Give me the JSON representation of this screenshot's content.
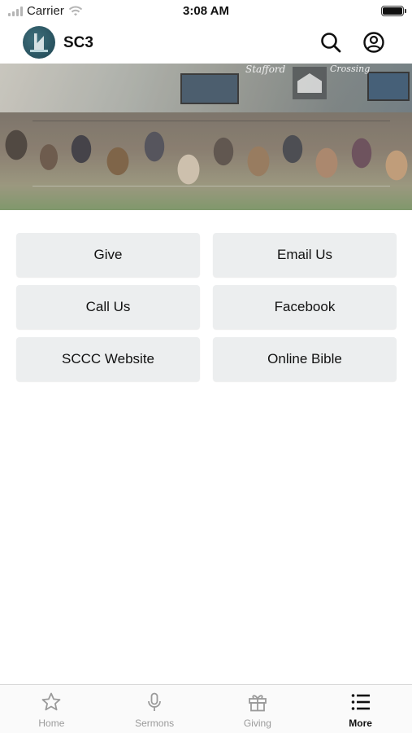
{
  "status_bar": {
    "carrier": "Carrier",
    "time": "3:08 AM",
    "signal_icon": "signal-bars-icon",
    "wifi_icon": "wifi-icon",
    "battery_icon": "battery-icon"
  },
  "header": {
    "title": "SC3",
    "logo_icon": "church-logo-icon",
    "search_icon": "search-icon",
    "account_icon": "account-circle-icon"
  },
  "banner": {
    "sign_left": "Stafford",
    "sign_right": "Crossing"
  },
  "actions": [
    {
      "label": "Give"
    },
    {
      "label": "Email Us"
    },
    {
      "label": "Call Us"
    },
    {
      "label": "Facebook"
    },
    {
      "label": "SCCC Website"
    },
    {
      "label": "Online Bible"
    }
  ],
  "tabs": [
    {
      "label": "Home",
      "icon": "star-icon",
      "active": false
    },
    {
      "label": "Sermons",
      "icon": "microphone-icon",
      "active": false
    },
    {
      "label": "Giving",
      "icon": "gift-icon",
      "active": false
    },
    {
      "label": "More",
      "icon": "list-icon",
      "active": true
    }
  ],
  "colors": {
    "button_bg": "#eceeef",
    "logo": "#2b5562",
    "tab_inactive": "#9a9a9a",
    "tab_active": "#111111"
  }
}
